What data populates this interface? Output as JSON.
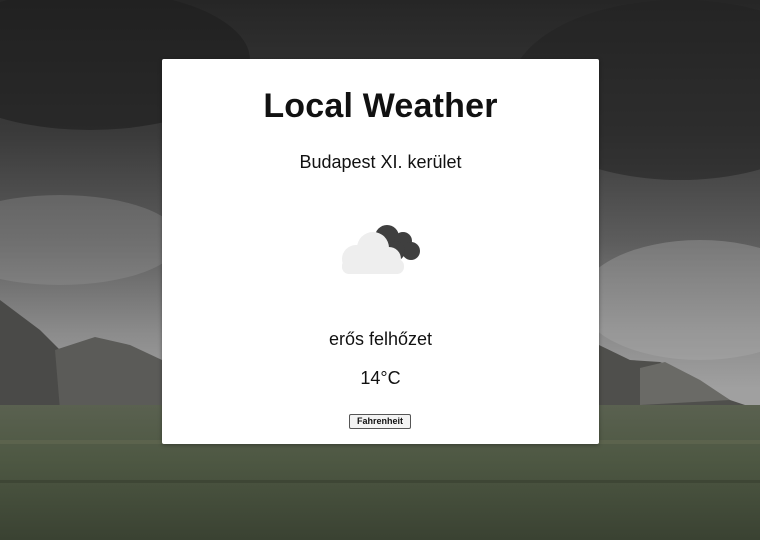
{
  "app": {
    "title": "Local Weather"
  },
  "weather": {
    "location": "Budapest XI. kerület",
    "icon": "broken-clouds-icon",
    "description": "erős felhőzet",
    "temperature": "14°C"
  },
  "controls": {
    "unit_toggle_label": "Fahrenheit"
  },
  "colors": {
    "card_background": "#ffffff",
    "text": "#111111",
    "cloud_dark": "#3f3f3f",
    "cloud_light": "#eeeeee"
  }
}
